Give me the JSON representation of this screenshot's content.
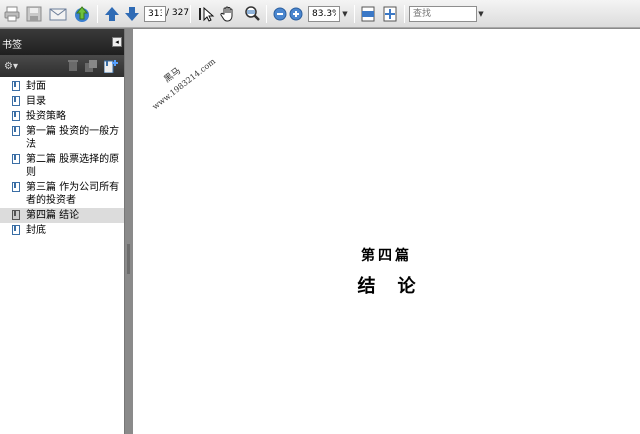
{
  "toolbar": {
    "current_page": "313",
    "page_total": "/ 327",
    "zoom": "83.3%",
    "search_placeholder": "查找",
    "icons": [
      "print-icon",
      "save-icon",
      "email-icon",
      "upload-icon",
      "prev-page-icon",
      "next-page-icon",
      "select-tool-icon",
      "hand-tool-icon",
      "zoom-tool-icon",
      "zoom-out-icon",
      "zoom-in-icon",
      "fit-width-icon",
      "fit-page-icon"
    ]
  },
  "sidebar": {
    "title": "书签",
    "collapse_glyph": "◂",
    "options_glyph": "⚙▾",
    "items": [
      {
        "label": "封面"
      },
      {
        "label": "目录"
      },
      {
        "label": "投资策略"
      },
      {
        "label": "第一篇 投资的一般方法"
      },
      {
        "label": "第二篇 股票选择的原则"
      },
      {
        "label": "第三篇 作为公司所有者的投资者"
      },
      {
        "label": "第四篇 结论",
        "selected": true
      },
      {
        "label": "封底"
      }
    ]
  },
  "document": {
    "watermark_line1": "黑马",
    "watermark_line2": "www.1983214.com",
    "chapter": "第四篇",
    "chapter_title": "结论"
  },
  "colors": {
    "accent_blue": "#2f6bb5",
    "panel_header": "#2a2a2a",
    "selected_row": "#dcdcdc"
  }
}
